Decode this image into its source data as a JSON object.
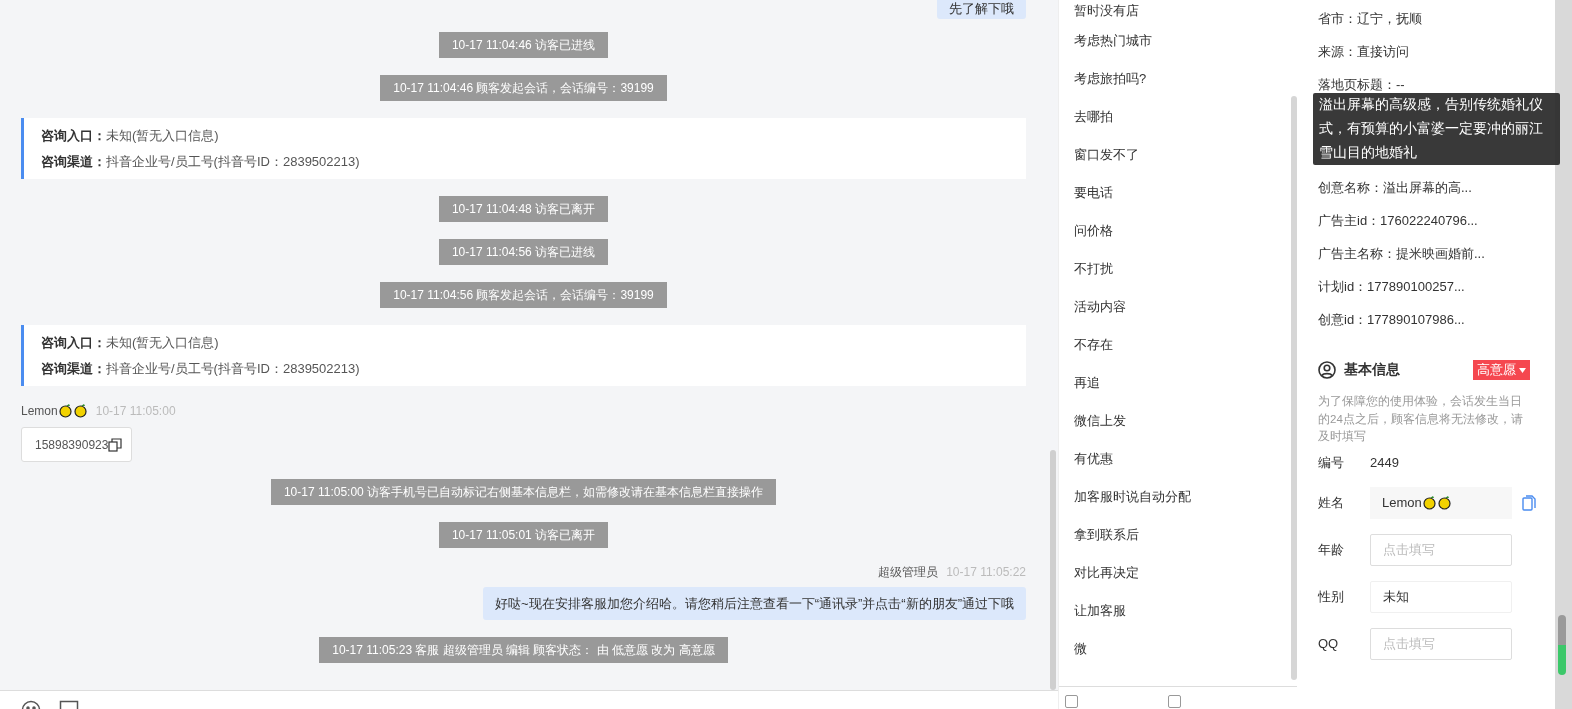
{
  "chat": {
    "messages": [
      {
        "kind": "agent",
        "text": "先了解下哦"
      },
      {
        "kind": "system",
        "text": "10-17 11:04:46 访客已进线"
      },
      {
        "kind": "system",
        "text": "10-17 11:04:46 顾客发起会话，会话编号：39199"
      },
      {
        "kind": "info",
        "rows": [
          {
            "label": "咨询入口：",
            "value": "未知(暂无入口信息)"
          },
          {
            "label": "咨询渠道：",
            "value": "抖音企业号/员工号(抖音号ID：2839502213)"
          }
        ]
      },
      {
        "kind": "system",
        "text": "10-17 11:04:48 访客已离开"
      },
      {
        "kind": "system",
        "text": "10-17 11:04:56 访客已进线"
      },
      {
        "kind": "system",
        "text": "10-17 11:04:56 顾客发起会话，会话编号：39199"
      },
      {
        "kind": "info",
        "rows": [
          {
            "label": "咨询入口：",
            "value": "未知(暂无入口信息)"
          },
          {
            "label": "咨询渠道：",
            "value": "抖音企业号/员工号(抖音号ID：2839502213)"
          }
        ]
      },
      {
        "kind": "visitor",
        "sender": "Lemon",
        "time": "10-17 11:05:00",
        "text": "15898390923"
      },
      {
        "kind": "system",
        "text": "10-17 11:05:00 访客手机号已自动标记右侧基本信息栏，如需修改请在基本信息栏直接操作"
      },
      {
        "kind": "system",
        "text": "10-17 11:05:01 访客已离开"
      },
      {
        "kind": "agent",
        "sender": "超级管理员",
        "time": "10-17 11:05:22",
        "text": "好哒~现在安排客服加您介绍哈。请您稍后注意查看一下“通讯录”并点击“新的朋友”通过下哦"
      },
      {
        "kind": "system",
        "text": "10-17 11:05:23 客服 超级管理员 编辑 顾客状态： 由 低意愿 改为 高意愿"
      }
    ]
  },
  "quick_replies": {
    "items": [
      "暂时没有店",
      "考虑热门城市",
      "考虑旅拍吗?",
      "去哪拍",
      "窗口发不了",
      "要电话",
      "问价格",
      "不打扰",
      "活动内容",
      "不存在",
      "再追",
      "微信上发",
      "有优惠",
      "加客服时说自动分配",
      "拿到联系后",
      "对比再决定",
      "让加客服",
      "微"
    ],
    "checkboxes": [
      {
        "checked": false
      },
      {
        "checked": false
      }
    ]
  },
  "customer": {
    "attributes": [
      {
        "kind": "row",
        "text": "省市：辽宁，抚顺"
      },
      {
        "kind": "row",
        "text": "来源：直接访问"
      },
      {
        "kind": "row",
        "text": "落地页标题：--"
      },
      {
        "kind": "tooltip",
        "text": "溢出屏幕的高级感，告别传统婚礼仪式，有预算的小富婆一定要冲的丽江雪山目的地婚礼"
      },
      {
        "kind": "row",
        "text": "创意名称：溢出屏幕的高..."
      },
      {
        "kind": "row",
        "text": "广告主id：176022240796..."
      },
      {
        "kind": "row",
        "text": "广告主名称：提米映画婚前..."
      },
      {
        "kind": "row",
        "text": "计划id：177890100257..."
      },
      {
        "kind": "row",
        "text": "创意id：177890107986..."
      }
    ],
    "section_title": "基本信息",
    "intent": "高意愿",
    "notice": "为了保障您的使用体验，会话发生当日的24点之后，顾客信息将无法修改，请及时填写",
    "fields": [
      {
        "kind": "text",
        "label": "编号",
        "value": "2449"
      },
      {
        "kind": "name",
        "label": "姓名",
        "value": "Lemon"
      },
      {
        "kind": "input",
        "label": "年龄",
        "placeholder": "点击填写"
      },
      {
        "kind": "select",
        "label": "性别",
        "value": "未知"
      },
      {
        "kind": "input",
        "label": "QQ",
        "placeholder": "点击填写"
      }
    ]
  }
}
